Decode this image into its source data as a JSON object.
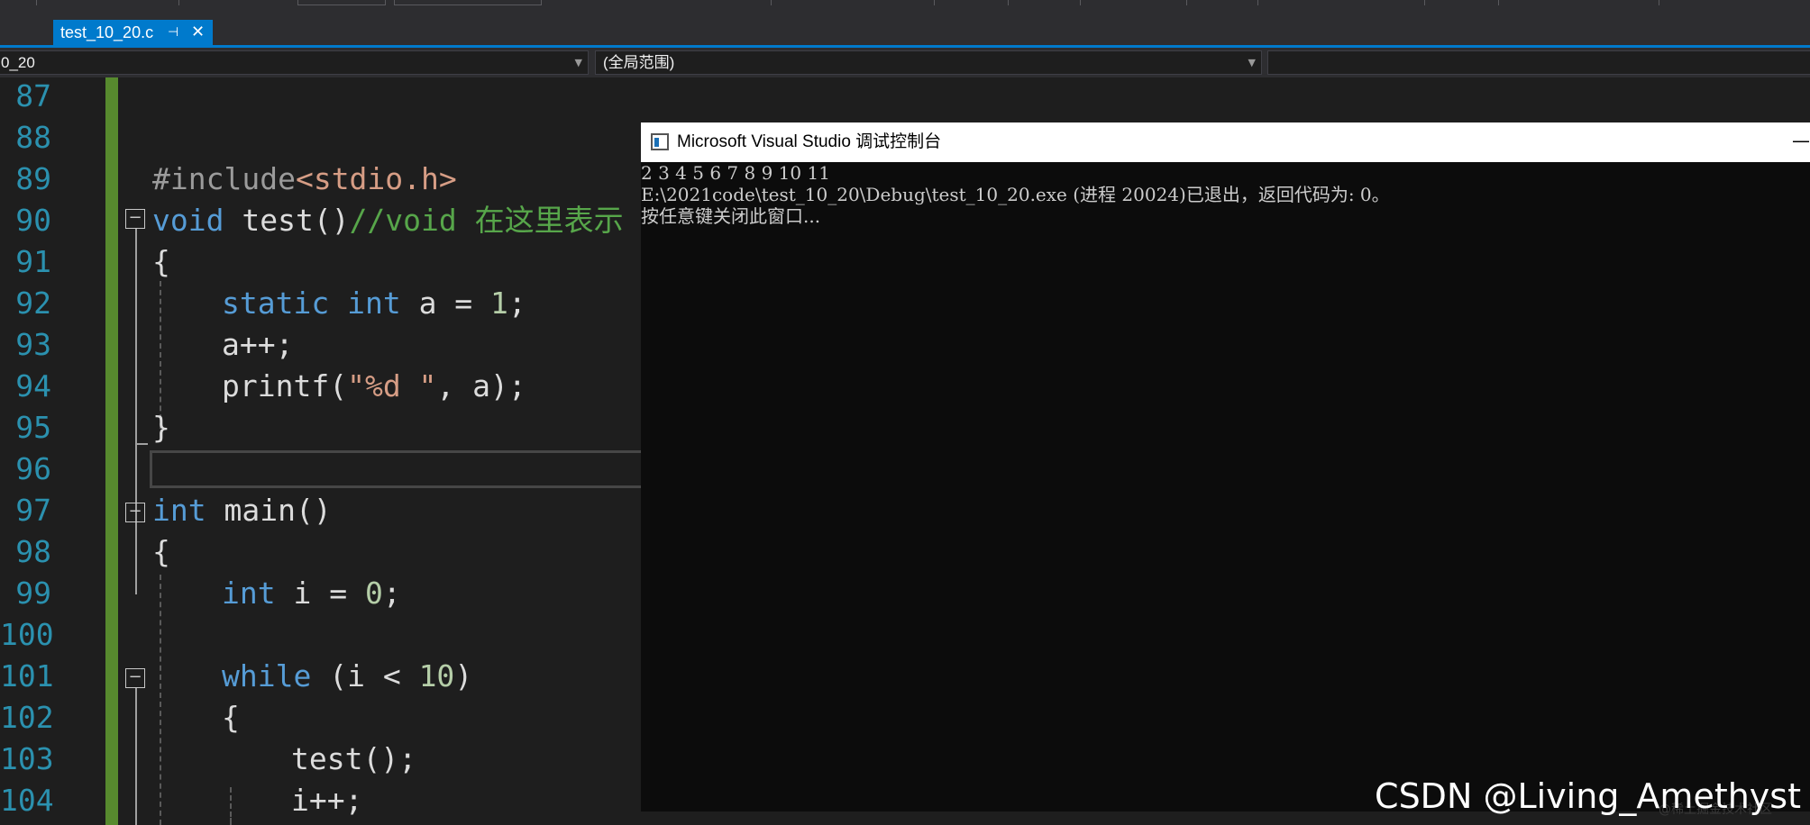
{
  "tab": {
    "label": "test_10_20.c",
    "pin_icon": "pin-icon",
    "close_icon": "close-icon"
  },
  "nav": {
    "project": "0_20",
    "scope": "(全局范围)",
    "function": ""
  },
  "editor": {
    "line_numbers": [
      "87",
      "88",
      "89",
      "90",
      "91",
      "92",
      "93",
      "94",
      "95",
      "96",
      "97",
      "98",
      "99",
      "100",
      "101",
      "102",
      "103",
      "104"
    ],
    "code": {
      "l89_pp": "#include",
      "l89_inc": "<stdio.h>",
      "l90_kw": "void",
      "l90_rest": " test()",
      "l90_cmt": "//void 在这里表示",
      "l91": "{",
      "l92_kw1": "static",
      "l92_kw2": " int",
      "l92_rest": " a = ",
      "l92_num": "1",
      "l92_end": ";",
      "l93": "a++;",
      "l94_fn": "printf(",
      "l94_str": "\"%d \"",
      "l94_rest": ", a);",
      "l95": "}",
      "l97_kw": "int",
      "l97_rest": " main()",
      "l98": "{",
      "l99_kw": "int",
      "l99_rest": " i = ",
      "l99_num": "0",
      "l99_end": ";",
      "l101_kw": "while",
      "l101_rest": " (i < ",
      "l101_num": "10",
      "l101_end": ")",
      "l102": "{",
      "l103": "test();",
      "l104": "i++;"
    }
  },
  "console": {
    "title": "Microsoft Visual Studio 调试控制台",
    "lines": [
      "2 3 4 5 6 7 8 9 10 11",
      "E:\\2021code\\test_10_20\\Debug\\test_10_20.exe (进程 20024)已退出，返回代码为: 0。",
      "按任意键关闭此窗口..."
    ],
    "minimize_icon": "minimize-icon"
  },
  "watermark": {
    "text": "CSDN @Living_Amethyst",
    "faint": "@稀土掘金技术社区"
  },
  "colors": {
    "accent": "#007acc",
    "change_bar": "#578a2e",
    "keyword": "#569cd6",
    "string": "#d69d85",
    "comment": "#57a64a",
    "line_number": "#2b91af"
  }
}
